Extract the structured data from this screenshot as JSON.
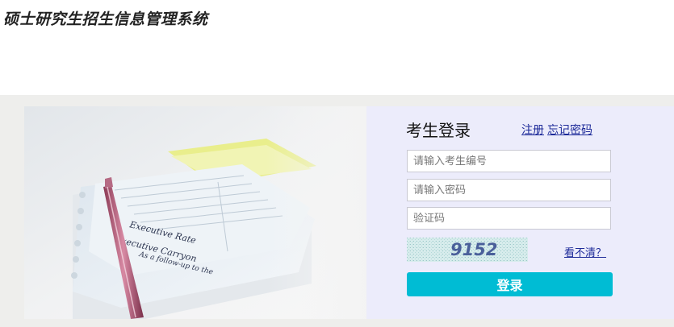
{
  "header": {
    "title": "硕士研究生招生信息管理系统"
  },
  "login": {
    "title": "考生登录",
    "register_link": "注册",
    "forgot_link": "忘记密码",
    "fields": {
      "candidate_id_placeholder": "请输入考生编号",
      "password_placeholder": "请输入密码",
      "captcha_placeholder": "验证码"
    },
    "captcha_text": "9152",
    "refresh_link": "看不清？",
    "submit_label": "登录"
  },
  "hero": {
    "paper_lines": [
      "Executive Rate",
      "Executive Carryon",
      "As a follow-up to the"
    ]
  },
  "colors": {
    "accent": "#00bcd4",
    "panel_bg": "#ececfb",
    "band_bg": "#eeeeec",
    "link": "#1d2a99"
  }
}
